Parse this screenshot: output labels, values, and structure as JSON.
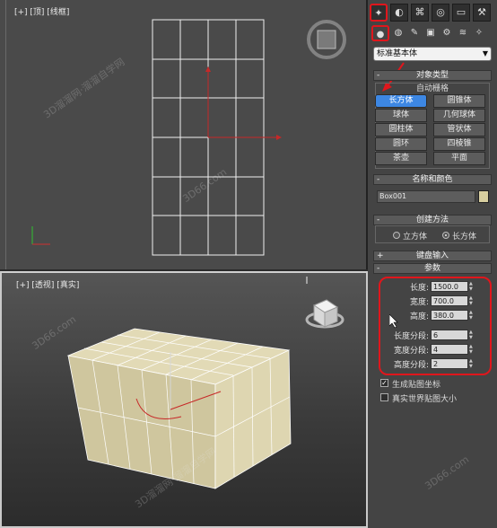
{
  "viewports": {
    "top_label": "[+] [顶] [线框]",
    "persp_label": "[+] [透视] [真实]"
  },
  "command_panel": {
    "tabs": [
      {
        "name": "create-tab",
        "glyph": "✦"
      },
      {
        "name": "modify-tab",
        "glyph": "◐"
      },
      {
        "name": "hierarchy-tab",
        "glyph": "⌘"
      },
      {
        "name": "motion-tab",
        "glyph": "◎"
      },
      {
        "name": "display-tab",
        "glyph": "▭"
      },
      {
        "name": "utilities-tab",
        "glyph": "⚒"
      }
    ],
    "subtypes": [
      "●",
      "◍",
      "✎",
      "▣",
      "⚙",
      "≋",
      "✧"
    ],
    "category_dropdown": "标准基本体",
    "object_type": {
      "title": "对象类型",
      "autogrid": "自动栅格",
      "buttons": [
        "长方体",
        "圆锥体",
        "球体",
        "几何球体",
        "圆柱体",
        "管状体",
        "圆环",
        "四棱锥",
        "茶壶",
        "平面"
      ],
      "selected": "长方体"
    },
    "name_color": {
      "title": "名称和颜色",
      "name_value": "Box001",
      "swatch_color": "#d8cfa0"
    },
    "creation_method": {
      "title": "创建方法",
      "options": [
        "立方体",
        "长方体"
      ],
      "selected": "长方体"
    },
    "keyboard_entry": {
      "title": "键盘输入"
    },
    "parameters": {
      "title": "参数",
      "fields": [
        {
          "label": "长度:",
          "value": "1500.0"
        },
        {
          "label": "宽度:",
          "value": "700.0"
        },
        {
          "label": "高度:",
          "value": "380.0"
        },
        {
          "label": "长度分段:",
          "value": "6"
        },
        {
          "label": "宽度分段:",
          "value": "4"
        },
        {
          "label": "高度分段:",
          "value": "2"
        }
      ],
      "gen_map_coords": {
        "label": "生成贴图坐标",
        "checked": true
      },
      "real_world_map": {
        "label": "真实世界贴图大小",
        "checked": false
      }
    }
  },
  "watermarks": [
    "3D溜溜网·溜溜自学网",
    "3D66.com"
  ],
  "colors": {
    "highlight": "#e0161c",
    "selected_button": "#3d87e3",
    "box_color": "#ded6b1"
  }
}
